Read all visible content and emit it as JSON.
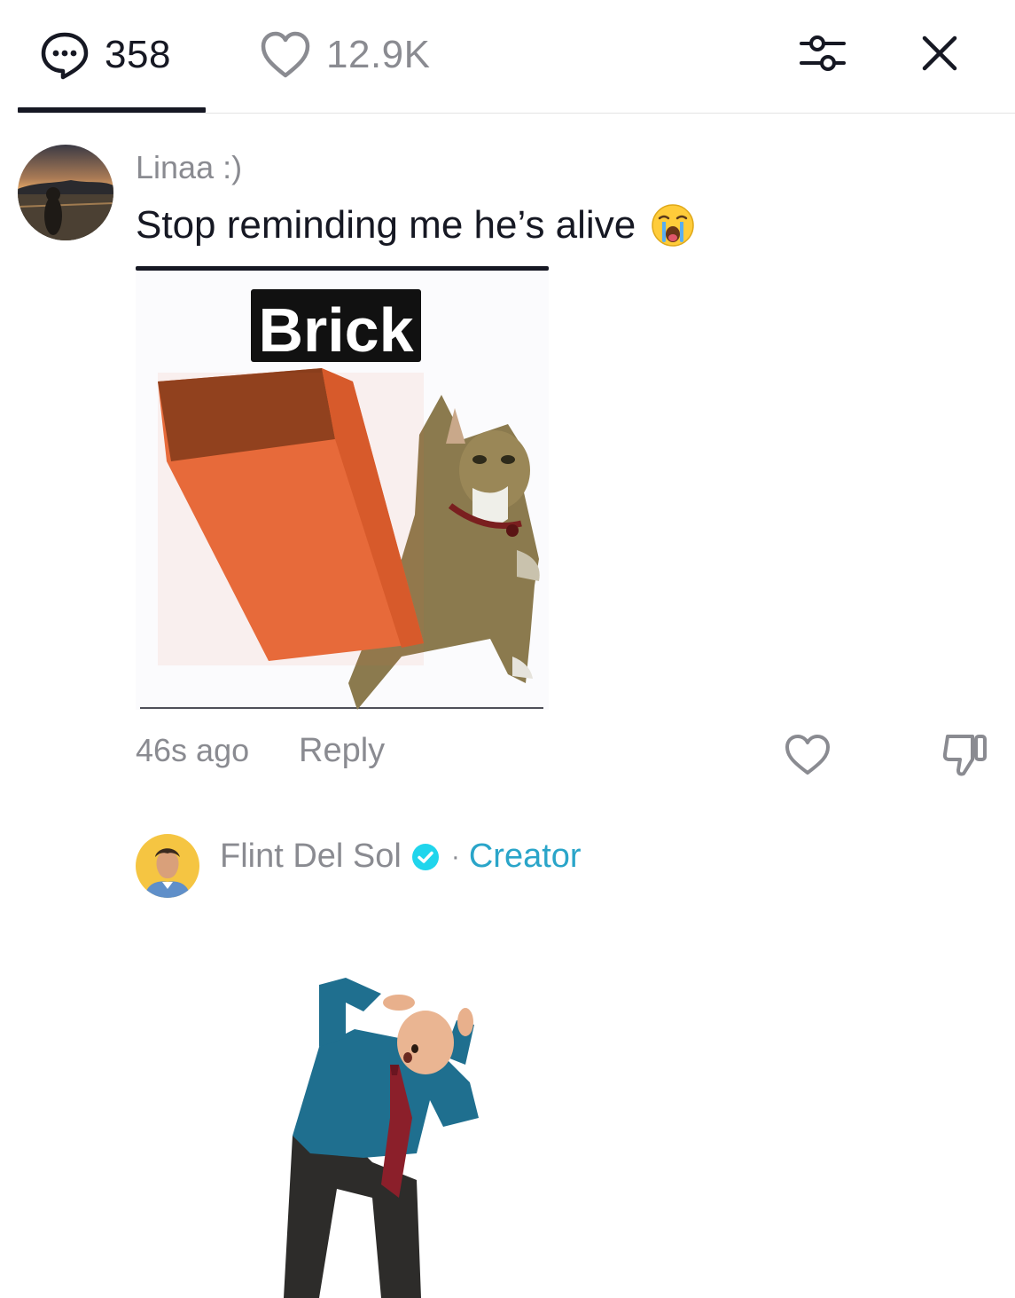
{
  "header": {
    "comments_count": "358",
    "likes_count": "12.9K",
    "comments_icon": "comment-bubble-icon",
    "likes_icon": "heart-outline-icon",
    "filter_icon": "sliders-icon",
    "close_icon": "close-icon"
  },
  "comment": {
    "username": "Linaa :)",
    "text": "Stop reminding me he’s alive",
    "emoji": "loudly-crying-face",
    "sticker_caption": "Brick",
    "timestamp": "46s ago",
    "reply_label": "Reply"
  },
  "reply": {
    "username": "Flint Del Sol",
    "separator": "·",
    "badge": "Creator"
  },
  "colors": {
    "primary_text": "#161823",
    "secondary_text": "#8a8b91",
    "creator_accent": "#2aa5c9",
    "verified_blue": "#20d5ec"
  }
}
